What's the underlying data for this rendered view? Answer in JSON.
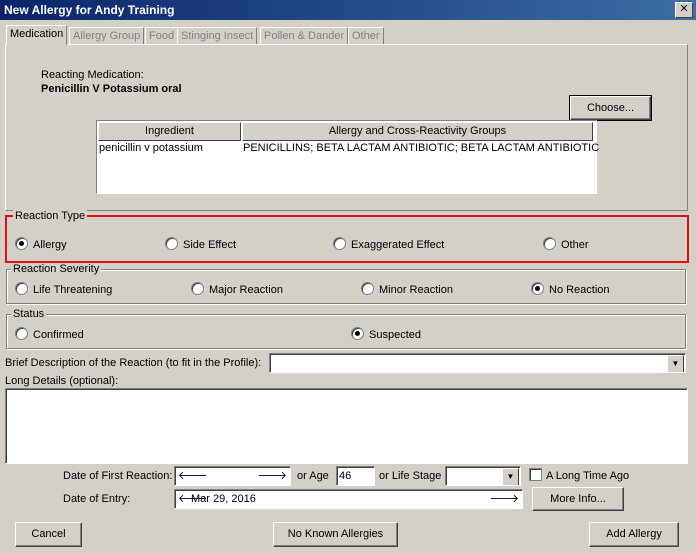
{
  "window": {
    "title": "New Allergy for Andy Training",
    "close_glyph": "✕"
  },
  "tabs": [
    "Medication",
    "Allergy Group",
    "Food",
    "Stinging Insect",
    "Pollen & Dander",
    "Other"
  ],
  "medication": {
    "reacting_label": "Reacting Medication:",
    "reacting_value": "Penicillin V Potassium oral",
    "choose_button": "Choose...",
    "grid": {
      "headers": [
        "Ingredient",
        "Allergy and Cross-Reactivity Groups"
      ],
      "rows": [
        [
          "penicillin v potassium",
          "PENICILLINS; BETA LACTAM ANTIBIOTIC; BETA LACTAM ANTIBIOTIC"
        ]
      ]
    }
  },
  "reaction_type": {
    "label": "Reaction Type",
    "options": [
      "Allergy",
      "Side Effect",
      "Exaggerated Effect",
      "Other"
    ],
    "selected": "Allergy"
  },
  "reaction_severity": {
    "label": "Reaction Severity",
    "options": [
      "Life Threatening",
      "Major Reaction",
      "Minor Reaction",
      "No Reaction"
    ],
    "selected": "No Reaction"
  },
  "status": {
    "label": "Status",
    "options": [
      "Confirmed",
      "Suspected"
    ],
    "selected": "Suspected"
  },
  "brief_description": {
    "label": "Brief Description of the Reaction (to fit in the Profile):",
    "value": ""
  },
  "long_details": {
    "label": "Long Details (optional):",
    "value": ""
  },
  "first_reaction": {
    "label": "Date of First Reaction:",
    "value": "",
    "age_label": "or Age",
    "age_value": "46",
    "life_stage_label": "or Life Stage",
    "life_stage_value": "",
    "long_time_ago_label": "A Long Time Ago"
  },
  "entry": {
    "label": "Date of Entry:",
    "value": "Mar 29, 2016",
    "more_info_button": "More Info..."
  },
  "footer": {
    "cancel": "Cancel",
    "no_known": "No Known Allergies",
    "add": "Add Allergy"
  },
  "colors": {
    "highlight_border": "#e01010",
    "titlebar": "#0a246a"
  }
}
